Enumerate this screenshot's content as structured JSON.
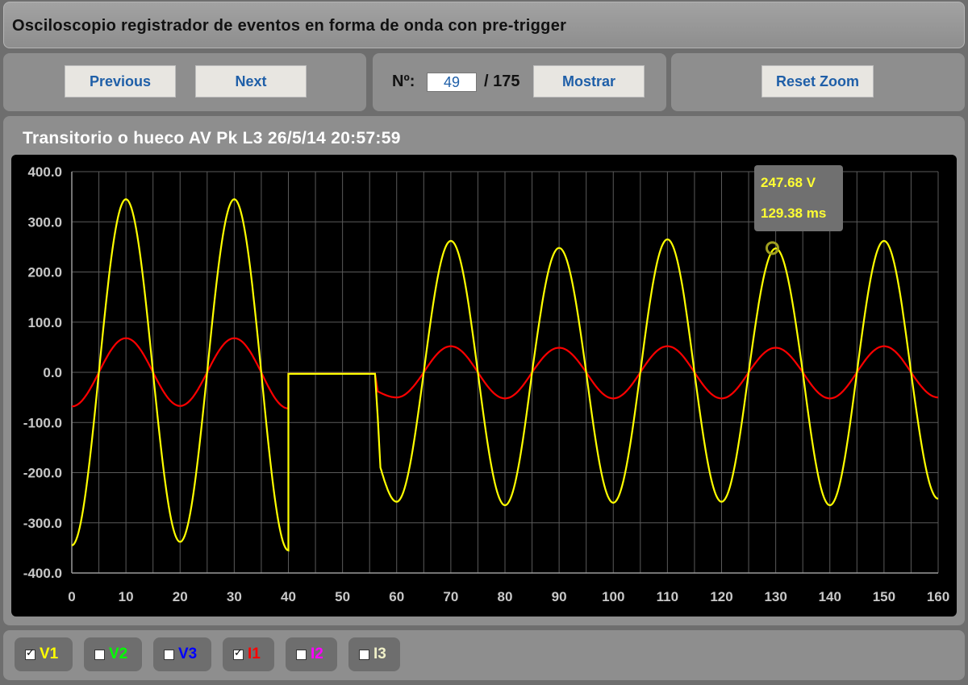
{
  "header": {
    "title": "Osciloscopio registrador de eventos en forma de onda con pre-trigger"
  },
  "nav": {
    "previous_label": "Previous",
    "next_label": "Next",
    "number_label": "Nº:",
    "current_value": "49",
    "total_label": "/ 175",
    "show_label": "Mostrar",
    "reset_zoom_label": "Reset Zoom"
  },
  "tooltip": {
    "voltage": "247.68 V",
    "time": "129.38 ms"
  },
  "legend": [
    {
      "label": "V1",
      "checked": true,
      "color": "#ffff00"
    },
    {
      "label": "V2",
      "checked": false,
      "color": "#00ff00"
    },
    {
      "label": "V3",
      "checked": false,
      "color": "#0000ff"
    },
    {
      "label": "I1",
      "checked": true,
      "color": "#ff0000"
    },
    {
      "label": "I2",
      "checked": false,
      "color": "#ff00ff"
    },
    {
      "label": "I3",
      "checked": false,
      "color": "#f0f0c8"
    }
  ],
  "chart_data": {
    "type": "line",
    "title": "Transitorio o hueco AV Pk L3 26/5/14 20:57:59",
    "xlim": [
      0,
      160
    ],
    "ylim": [
      -400,
      400
    ],
    "x_ticks": [
      0,
      10,
      20,
      30,
      40,
      50,
      60,
      70,
      80,
      90,
      100,
      110,
      120,
      130,
      140,
      150,
      160
    ],
    "y_ticks": [
      -400,
      -300,
      -200,
      -100,
      0,
      100,
      200,
      300,
      400
    ],
    "y_tick_labels": [
      "-400.0",
      "-300.0",
      "-200.0",
      "-100.0",
      "0.0",
      "100.0",
      "200.0",
      "300.0",
      "400.0"
    ],
    "grid": true,
    "highlight_point": {
      "x": 129.38,
      "y": 247.68
    },
    "series": [
      {
        "name": "V1",
        "color": "#ffff00",
        "x": [
          0,
          5,
          10,
          15,
          20,
          25,
          30,
          35,
          40,
          40,
          45,
          50,
          56,
          56.5,
          57,
          60,
          65,
          70,
          75,
          80,
          85,
          90,
          95,
          100,
          105,
          110,
          115,
          120,
          125,
          130,
          135,
          140,
          145,
          150,
          155,
          160
        ],
        "y": [
          -345,
          0,
          345,
          0,
          -338,
          0,
          345,
          0,
          -355,
          -3,
          -3,
          -3,
          -3,
          -90,
          -190,
          -258,
          0,
          262,
          0,
          -265,
          0,
          248,
          0,
          -260,
          0,
          265,
          0,
          -258,
          0,
          247,
          0,
          -265,
          0,
          262,
          0,
          -252
        ]
      },
      {
        "name": "I1",
        "color": "#ff0000",
        "x": [
          0,
          5,
          10,
          15,
          20,
          25,
          30,
          35,
          40,
          40,
          45,
          50,
          56,
          56.5,
          60,
          65,
          70,
          75,
          80,
          85,
          90,
          95,
          100,
          105,
          110,
          115,
          120,
          125,
          130,
          135,
          140,
          145,
          150,
          155,
          160
        ],
        "y": [
          -68,
          0,
          68,
          0,
          -67,
          0,
          68,
          0,
          -72,
          -3,
          -3,
          -3,
          -3,
          -38,
          -50,
          0,
          52,
          0,
          -52,
          0,
          49,
          0,
          -52,
          0,
          52,
          0,
          -52,
          0,
          49,
          0,
          -52,
          0,
          52,
          0,
          -50
        ]
      }
    ]
  }
}
